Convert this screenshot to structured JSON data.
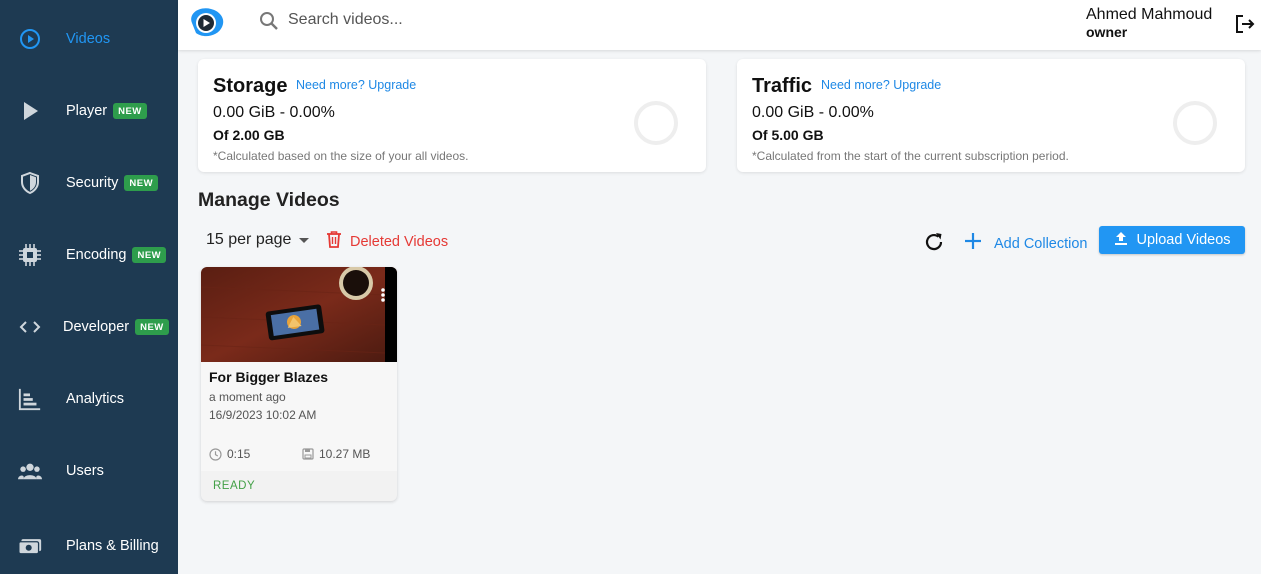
{
  "sidebar": {
    "items": [
      {
        "label": "Videos",
        "icon": "play-circle-icon",
        "active": true
      },
      {
        "label": "Player",
        "icon": "play-icon",
        "badge": "NEW"
      },
      {
        "label": "Security",
        "icon": "shield-icon",
        "badge": "NEW"
      },
      {
        "label": "Encoding",
        "icon": "chip-icon",
        "badge": "NEW"
      },
      {
        "label": "Developer",
        "icon": "code-icon",
        "badge": "NEW"
      },
      {
        "label": "Analytics",
        "icon": "bar-chart-icon"
      },
      {
        "label": "Users",
        "icon": "users-icon"
      },
      {
        "label": "Plans & Billing",
        "icon": "money-icon"
      }
    ]
  },
  "header": {
    "search_placeholder": "Search videos...",
    "user_name": "Ahmed Mahmoud",
    "user_role": "owner"
  },
  "storage": {
    "title": "Storage",
    "upgrade": "Need more? Upgrade",
    "usage": "0.00 GiB - 0.00%",
    "total": "Of 2.00 GB",
    "note": "*Calculated based on the size of your all videos.",
    "percent": 0
  },
  "traffic": {
    "title": "Traffic",
    "upgrade": "Need more? Upgrade",
    "usage": "0.00 GiB - 0.00%",
    "total": "Of 5.00 GB",
    "note": "*Calculated from the start of the current subscription period.",
    "percent": 0
  },
  "manage": {
    "title": "Manage Videos",
    "per_page": "15 per page",
    "deleted_label": "Deleted Videos",
    "add_collection_label": "Add Collection",
    "upload_label": "Upload Videos"
  },
  "videos": [
    {
      "title": "For Bigger Blazes",
      "age": "a moment ago",
      "date": "16/9/2023 10:02 AM",
      "duration": "0:15",
      "size": "10.27 MB",
      "status": "READY"
    }
  ],
  "colors": {
    "sidebar_bg": "#1e3a52",
    "accent": "#2196f3",
    "danger": "#e53935",
    "success": "#43a047",
    "badge": "#2e9d4c"
  }
}
